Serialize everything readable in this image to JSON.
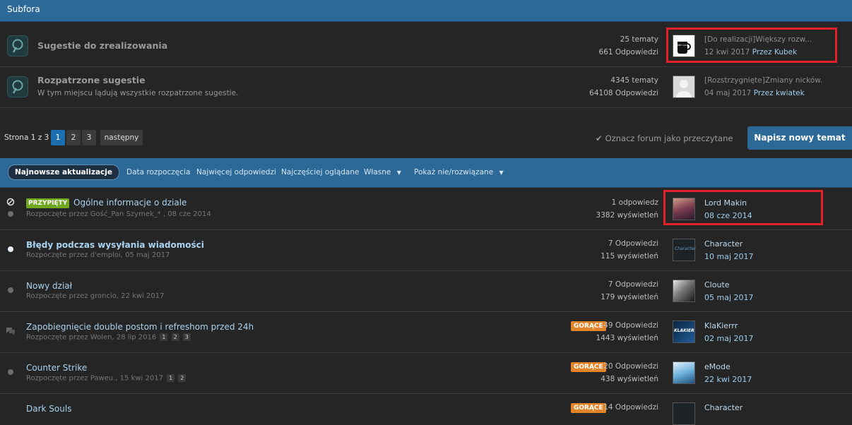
{
  "subfora": {
    "title": "Subfora"
  },
  "forums": [
    {
      "title": "Sugestie do zrealizowania",
      "description": "",
      "topics": "25 tematy",
      "replies": "661 Odpowiedzi",
      "last_post_title": "[Do realizacji]Większy rozw...",
      "last_post_date": "12 kwi 2017",
      "last_post_by": "Przez Kubek",
      "avatar_text": "KEEP CALM DRINK COFFEE"
    },
    {
      "title": "Rozpatrzone sugestie",
      "description": "W tym miejscu lądują wszystkie rozpatrzone sugestie.",
      "topics": "4345 tematy",
      "replies": "64108 Odpowiedzi",
      "last_post_title": "[Rozstrzygnięte]Zmiany nicków.",
      "last_post_date": "04 maj 2017",
      "last_post_by": "Przez kwiatek"
    }
  ],
  "pagination": {
    "label": "Strona 1 z 3",
    "pages": [
      "1",
      "2",
      "3"
    ],
    "next": "następny"
  },
  "mark_read": "Oznacz forum jako przeczytane",
  "new_topic": "Napisz nowy temat",
  "filters": {
    "active": "Najnowsze aktualizacje",
    "links": [
      "Data rozpoczęcia",
      "Najwięcej odpowiedzi",
      "Najczęściej oglądane",
      "Własne",
      "Pokaż nie/rozwiązane"
    ]
  },
  "topics": [
    {
      "badge": "PRZYPIĘTY",
      "title": "Ogólne informacje o dziale",
      "meta": "Rozpoczęte przez Gość_Pan Szymek_* , 08 cze 2014",
      "replies": "1 odpowiedz",
      "views": "3382 wyświetleń",
      "last_user": "Lord Makin",
      "last_date": "08 cze 2014"
    },
    {
      "title": "Błędy podczas wysyłania wiadomości",
      "meta": "Rozpoczęte przez d'emploi, 05 maj 2017",
      "replies": "7 Odpowiedzi",
      "views": "115 wyświetleń",
      "last_user": "Character",
      "last_date": "10 maj 2017",
      "avatar_text": "Character"
    },
    {
      "title": "Nowy dział",
      "meta": "Rozpoczęte przez groncio, 22 kwi 2017",
      "replies": "7 Odpowiedzi",
      "views": "179 wyświetleń",
      "last_user": "Cloute",
      "last_date": "05 maj 2017"
    },
    {
      "badge": "GORĄCE",
      "title": "Zapobiegnięcie double postom i refreshom przed 24h",
      "meta": "Rozpoczęte przez Wolen, 28 lip 2016",
      "pages": [
        "1",
        "2",
        "3"
      ],
      "replies": "49 Odpowiedzi",
      "views": "1443 wyświetleń",
      "last_user": "KlaKierrr",
      "last_date": "02 maj 2017",
      "avatar_text": "KLAKIER"
    },
    {
      "badge": "GORĄCE",
      "title": "Counter Strike",
      "meta": "Rozpoczęte przez Paweu., 15 kwi 2017",
      "pages": [
        "1",
        "2"
      ],
      "replies": "20 Odpowiedzi",
      "views": "438 wyświetleń",
      "last_user": "eMode",
      "last_date": "22 kwi 2017"
    },
    {
      "badge": "GORĄCE",
      "title": "Dark Souls",
      "replies": "14 Odpowiedzi",
      "last_user": "Character"
    }
  ],
  "colors": {
    "header_blue": "#2c6997",
    "highlight_red": "#e4202a",
    "pinned_green": "#6fa71f",
    "hot_orange": "#e2852a"
  }
}
